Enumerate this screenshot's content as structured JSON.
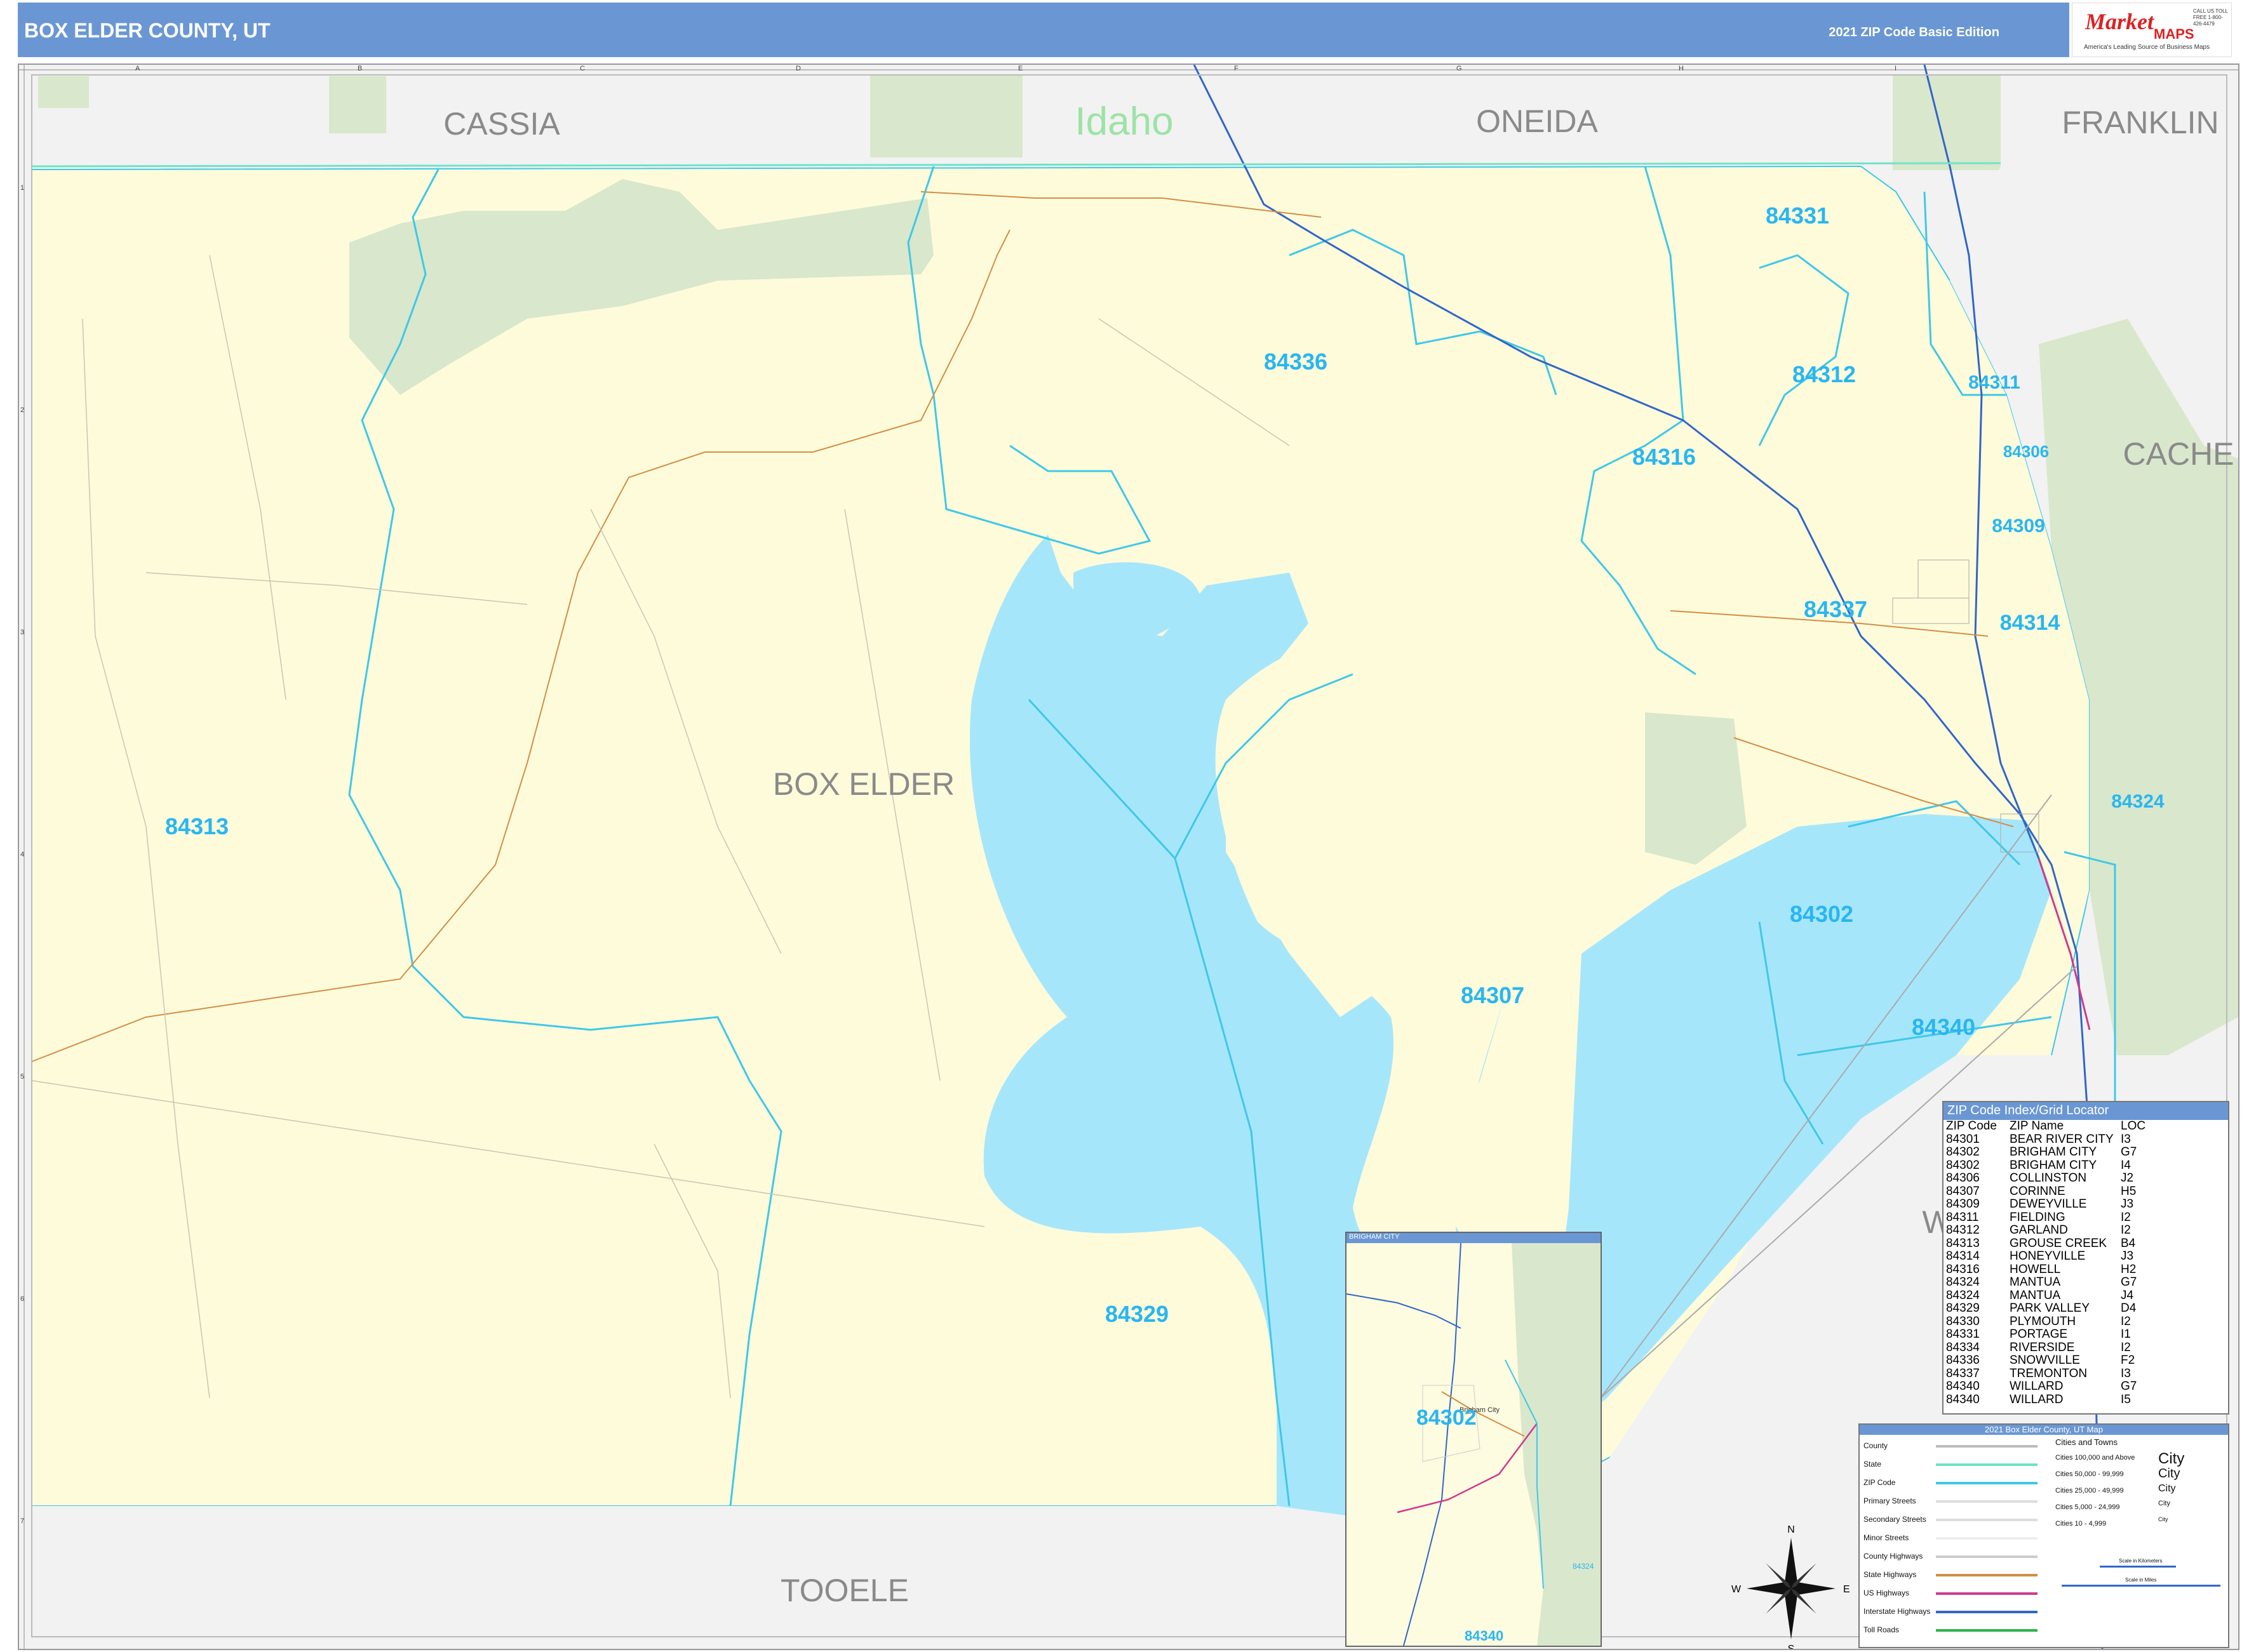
{
  "header": {
    "title": "BOX ELDER COUNTY, UT",
    "edition": "2021 ZIP Code Basic Edition",
    "logo_brand": "Market",
    "logo_maps": "MAPS",
    "logo_tagline": "America's Leading Source of Business Maps",
    "logo_phone": "CALL US TOLL FREE 1-800-426-4479"
  },
  "grid": {
    "columns": [
      "A",
      "B",
      "C",
      "D",
      "E",
      "F",
      "G",
      "H",
      "I"
    ],
    "rows": [
      "1",
      "2",
      "3",
      "4",
      "5",
      "6",
      "7"
    ]
  },
  "neighbors": {
    "cassia": "CASSIA",
    "idaho": "Idaho",
    "oneida": "ONEIDA",
    "franklin": "FRANKLIN",
    "cache": "CACHE",
    "box_elder": "BOX ELDER",
    "tooele": "TOOELE",
    "weber": "W"
  },
  "zip_labels": [
    "84331",
    "84336",
    "84312",
    "84311",
    "84316",
    "84306",
    "84309",
    "84337",
    "84314",
    "84313",
    "84324",
    "84302",
    "84307",
    "84340",
    "84329"
  ],
  "colors": {
    "county_fill": "#fefbdb",
    "water": "#a6e6fb",
    "forest": "#d9e7cc",
    "zip_label": "#29b6f0",
    "zip_line": "#3ec8e8",
    "header": "#6a97d4"
  },
  "zip_index": {
    "title": "ZIP Code Index/Grid Locator",
    "headers": [
      "ZIP Code",
      "ZIP Name",
      "LOC"
    ],
    "rows": [
      [
        "84301",
        "BEAR RIVER CITY",
        "I3"
      ],
      [
        "84302",
        "BRIGHAM CITY",
        "G7"
      ],
      [
        "84302",
        "BRIGHAM CITY",
        "I4"
      ],
      [
        "84306",
        "COLLINSTON",
        "J2"
      ],
      [
        "84307",
        "CORINNE",
        "H5"
      ],
      [
        "84309",
        "DEWEYVILLE",
        "J3"
      ],
      [
        "84311",
        "FIELDING",
        "I2"
      ],
      [
        "84312",
        "GARLAND",
        "I2"
      ],
      [
        "84313",
        "GROUSE CREEK",
        "B4"
      ],
      [
        "84314",
        "HONEYVILLE",
        "J3"
      ],
      [
        "84316",
        "HOWELL",
        "H2"
      ],
      [
        "84324",
        "MANTUA",
        "G7"
      ],
      [
        "84324",
        "MANTUA",
        "J4"
      ],
      [
        "84329",
        "PARK VALLEY",
        "D4"
      ],
      [
        "84330",
        "PLYMOUTH",
        "I2"
      ],
      [
        "84331",
        "PORTAGE",
        "I1"
      ],
      [
        "84334",
        "RIVERSIDE",
        "I2"
      ],
      [
        "84336",
        "SNOWVILLE",
        "F2"
      ],
      [
        "84337",
        "TREMONTON",
        "I3"
      ],
      [
        "84340",
        "WILLARD",
        "G7"
      ],
      [
        "84340",
        "WILLARD",
        "I5"
      ]
    ]
  },
  "key": {
    "title": "2021 Box Elder County, UT Map",
    "line_items": [
      "County",
      "State",
      "ZIP Code",
      "Primary Streets",
      "Secondary Streets",
      "Minor Streets",
      "County Highways",
      "State Highways",
      "US Highways",
      "Interstate Highways",
      "Toll Roads"
    ],
    "cities_header": "Cities and Towns",
    "city_items": [
      "Cities 100,000 and Above",
      "Cities 50,000 - 99,999",
      "Cities 25,000 - 49,999",
      "Cities 5,000 - 24,999",
      "Cities 10 - 4,999"
    ],
    "city_samples": [
      "City",
      "City",
      "City",
      "City",
      "City"
    ],
    "scale_km": "Scale in Kilometers",
    "scale_mi": "Scale in Miles"
  },
  "inset": {
    "title": "BRIGHAM CITY",
    "zip_main": "84302",
    "zip_se": "84324",
    "zip_bottom": "84340",
    "city": "Brigham City"
  },
  "compass": {
    "n": "N",
    "s": "S",
    "e": "E",
    "w": "W"
  }
}
